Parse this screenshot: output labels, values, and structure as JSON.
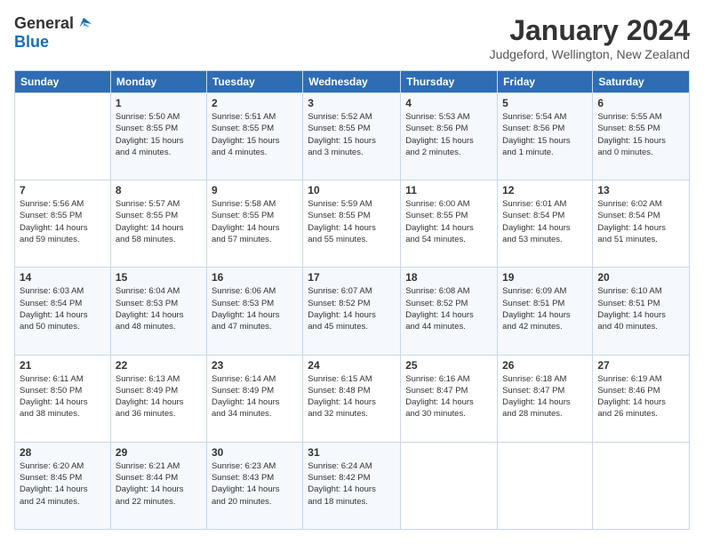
{
  "logo": {
    "general": "General",
    "blue": "Blue"
  },
  "title": "January 2024",
  "subtitle": "Judgeford, Wellington, New Zealand",
  "weekdays": [
    "Sunday",
    "Monday",
    "Tuesday",
    "Wednesday",
    "Thursday",
    "Friday",
    "Saturday"
  ],
  "weeks": [
    [
      {
        "day": "",
        "info": ""
      },
      {
        "day": "1",
        "info": "Sunrise: 5:50 AM\nSunset: 8:55 PM\nDaylight: 15 hours\nand 4 minutes."
      },
      {
        "day": "2",
        "info": "Sunrise: 5:51 AM\nSunset: 8:55 PM\nDaylight: 15 hours\nand 4 minutes."
      },
      {
        "day": "3",
        "info": "Sunrise: 5:52 AM\nSunset: 8:55 PM\nDaylight: 15 hours\nand 3 minutes."
      },
      {
        "day": "4",
        "info": "Sunrise: 5:53 AM\nSunset: 8:56 PM\nDaylight: 15 hours\nand 2 minutes."
      },
      {
        "day": "5",
        "info": "Sunrise: 5:54 AM\nSunset: 8:56 PM\nDaylight: 15 hours\nand 1 minute."
      },
      {
        "day": "6",
        "info": "Sunrise: 5:55 AM\nSunset: 8:55 PM\nDaylight: 15 hours\nand 0 minutes."
      }
    ],
    [
      {
        "day": "7",
        "info": "Sunrise: 5:56 AM\nSunset: 8:55 PM\nDaylight: 14 hours\nand 59 minutes."
      },
      {
        "day": "8",
        "info": "Sunrise: 5:57 AM\nSunset: 8:55 PM\nDaylight: 14 hours\nand 58 minutes."
      },
      {
        "day": "9",
        "info": "Sunrise: 5:58 AM\nSunset: 8:55 PM\nDaylight: 14 hours\nand 57 minutes."
      },
      {
        "day": "10",
        "info": "Sunrise: 5:59 AM\nSunset: 8:55 PM\nDaylight: 14 hours\nand 55 minutes."
      },
      {
        "day": "11",
        "info": "Sunrise: 6:00 AM\nSunset: 8:55 PM\nDaylight: 14 hours\nand 54 minutes."
      },
      {
        "day": "12",
        "info": "Sunrise: 6:01 AM\nSunset: 8:54 PM\nDaylight: 14 hours\nand 53 minutes."
      },
      {
        "day": "13",
        "info": "Sunrise: 6:02 AM\nSunset: 8:54 PM\nDaylight: 14 hours\nand 51 minutes."
      }
    ],
    [
      {
        "day": "14",
        "info": "Sunrise: 6:03 AM\nSunset: 8:54 PM\nDaylight: 14 hours\nand 50 minutes."
      },
      {
        "day": "15",
        "info": "Sunrise: 6:04 AM\nSunset: 8:53 PM\nDaylight: 14 hours\nand 48 minutes."
      },
      {
        "day": "16",
        "info": "Sunrise: 6:06 AM\nSunset: 8:53 PM\nDaylight: 14 hours\nand 47 minutes."
      },
      {
        "day": "17",
        "info": "Sunrise: 6:07 AM\nSunset: 8:52 PM\nDaylight: 14 hours\nand 45 minutes."
      },
      {
        "day": "18",
        "info": "Sunrise: 6:08 AM\nSunset: 8:52 PM\nDaylight: 14 hours\nand 44 minutes."
      },
      {
        "day": "19",
        "info": "Sunrise: 6:09 AM\nSunset: 8:51 PM\nDaylight: 14 hours\nand 42 minutes."
      },
      {
        "day": "20",
        "info": "Sunrise: 6:10 AM\nSunset: 8:51 PM\nDaylight: 14 hours\nand 40 minutes."
      }
    ],
    [
      {
        "day": "21",
        "info": "Sunrise: 6:11 AM\nSunset: 8:50 PM\nDaylight: 14 hours\nand 38 minutes."
      },
      {
        "day": "22",
        "info": "Sunrise: 6:13 AM\nSunset: 8:49 PM\nDaylight: 14 hours\nand 36 minutes."
      },
      {
        "day": "23",
        "info": "Sunrise: 6:14 AM\nSunset: 8:49 PM\nDaylight: 14 hours\nand 34 minutes."
      },
      {
        "day": "24",
        "info": "Sunrise: 6:15 AM\nSunset: 8:48 PM\nDaylight: 14 hours\nand 32 minutes."
      },
      {
        "day": "25",
        "info": "Sunrise: 6:16 AM\nSunset: 8:47 PM\nDaylight: 14 hours\nand 30 minutes."
      },
      {
        "day": "26",
        "info": "Sunrise: 6:18 AM\nSunset: 8:47 PM\nDaylight: 14 hours\nand 28 minutes."
      },
      {
        "day": "27",
        "info": "Sunrise: 6:19 AM\nSunset: 8:46 PM\nDaylight: 14 hours\nand 26 minutes."
      }
    ],
    [
      {
        "day": "28",
        "info": "Sunrise: 6:20 AM\nSunset: 8:45 PM\nDaylight: 14 hours\nand 24 minutes."
      },
      {
        "day": "29",
        "info": "Sunrise: 6:21 AM\nSunset: 8:44 PM\nDaylight: 14 hours\nand 22 minutes."
      },
      {
        "day": "30",
        "info": "Sunrise: 6:23 AM\nSunset: 8:43 PM\nDaylight: 14 hours\nand 20 minutes."
      },
      {
        "day": "31",
        "info": "Sunrise: 6:24 AM\nSunset: 8:42 PM\nDaylight: 14 hours\nand 18 minutes."
      },
      {
        "day": "",
        "info": ""
      },
      {
        "day": "",
        "info": ""
      },
      {
        "day": "",
        "info": ""
      }
    ]
  ]
}
